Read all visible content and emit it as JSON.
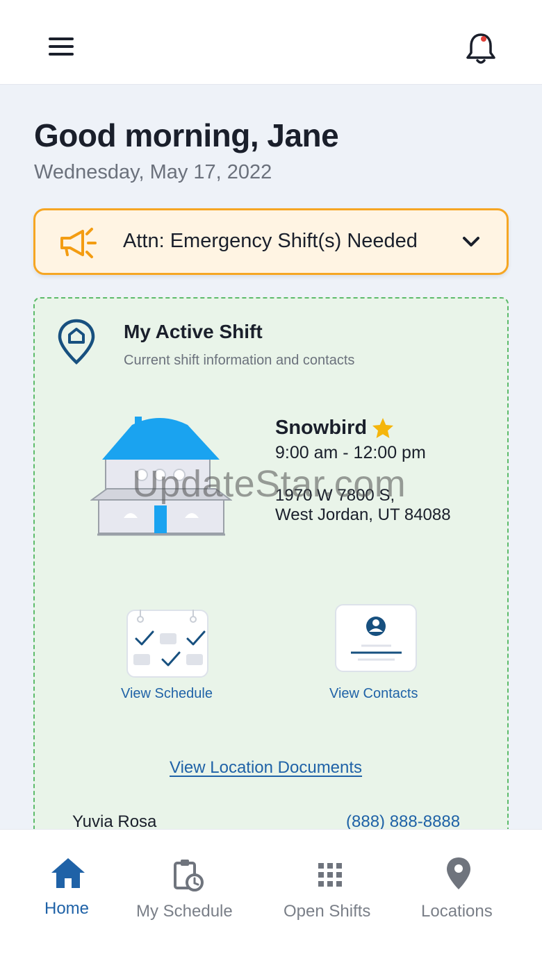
{
  "header": {
    "menu_icon": "hamburger-menu-icon",
    "bell_icon": "notification-bell-icon",
    "has_unread": true
  },
  "greeting": {
    "title": "Good morning, Jane",
    "date": "Wednesday, May 17, 2022"
  },
  "alert": {
    "icon": "megaphone-icon",
    "text": "Attn: Emergency Shift(s) Needed",
    "chevron_icon": "chevron-down-icon"
  },
  "active_shift": {
    "title": "My Active Shift",
    "subtitle": "Current shift information and contacts",
    "location": {
      "name": "Snowbird",
      "favorite": true,
      "hours": "9:00 am - 12:00 pm",
      "address_line1": "1970 W 7800 S,",
      "address_line2": "West Jordan, UT 84088"
    },
    "actions": {
      "schedule_label": "View Schedule",
      "contacts_label": "View Contacts"
    },
    "documents_link": "View Location Documents",
    "contact": {
      "name": "Yuvia Rosa",
      "phone": "(888) 888-8888"
    }
  },
  "watermark": "UpdateStar.com",
  "bottom_nav": {
    "items": [
      {
        "label": "Home",
        "icon": "home-icon",
        "active": true
      },
      {
        "label": "My Schedule",
        "icon": "clipboard-clock-icon",
        "active": false
      },
      {
        "label": "Open Shifts",
        "icon": "grid-dots-icon",
        "active": false
      },
      {
        "label": "Locations",
        "icon": "location-pin-icon",
        "active": false
      }
    ]
  },
  "colors": {
    "accent_blue": "#1f62a7",
    "alert_orange": "#f6a623",
    "alert_bg": "#fff4e3",
    "card_green_border": "#5cbb6a",
    "card_bg": "#e9f4e9",
    "house_roof": "#1aa3f0",
    "star": "#f5b50b"
  }
}
